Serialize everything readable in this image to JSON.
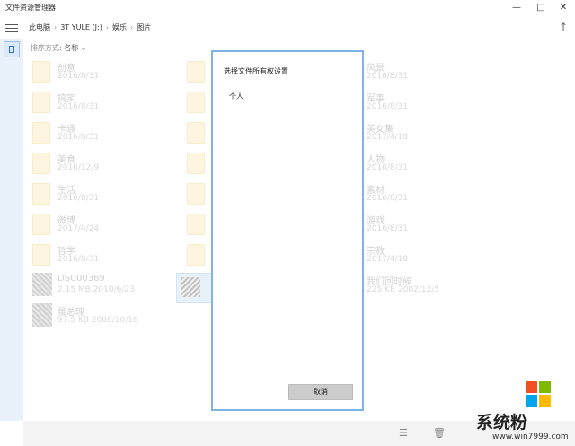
{
  "window": {
    "title": "文件资源管理器"
  },
  "nav": {
    "crumbs": [
      "此电脑",
      "3T YULE (J:)",
      "娱乐",
      "图片"
    ]
  },
  "sort": {
    "label": "排序方式:",
    "value": "名称"
  },
  "files": [
    {
      "name": "创意",
      "date": "2016/8/31",
      "kind": "folder"
    },
    {
      "name": "搞笑",
      "date": "2016/8/31",
      "kind": "folder"
    },
    {
      "name": "卡通",
      "date": "2016/8/31",
      "kind": "folder"
    },
    {
      "name": "美食",
      "date": "2016/12/9",
      "kind": "folder"
    },
    {
      "name": "生活",
      "date": "2016/8/31",
      "kind": "folder"
    },
    {
      "name": "微博",
      "date": "2017/4/24",
      "kind": "folder"
    },
    {
      "name": "哲学",
      "date": "2016/8/31",
      "kind": "folder"
    },
    {
      "name": "DSC00369",
      "date": "2.15 MB 2010/6/23",
      "kind": "image"
    },
    {
      "name": "虽总理",
      "date": "97.5 KB 2006/10/16",
      "kind": "image"
    },
    {
      "name": "风景",
      "date": "2016/8/31",
      "kind": "folder"
    },
    {
      "name": "军事",
      "date": "2016/8/31",
      "kind": "folder"
    },
    {
      "name": "美女集",
      "date": "2017/4/18",
      "kind": "folder"
    },
    {
      "name": "人物",
      "date": "2016/8/31",
      "kind": "folder"
    },
    {
      "name": "素材",
      "date": "2016/8/31",
      "kind": "folder"
    },
    {
      "name": "游戏",
      "date": "2016/8/31",
      "kind": "folder"
    },
    {
      "name": "宗教",
      "date": "2017/4/18",
      "kind": "folder"
    },
    {
      "name": "我们回时候",
      "date": "225 KB 2002/12/5",
      "kind": "image"
    }
  ],
  "dialog": {
    "title": "选择文件所有权设置",
    "option": "个人",
    "cancel_label": "取消"
  },
  "watermark": {
    "brand": "系统粉",
    "url": "www.win7999.com"
  },
  "icons": {
    "hamburger": "hamburger-icon",
    "up": "up-arrow-icon",
    "view": "list-view-icon",
    "delete": "trash-icon"
  },
  "colors": {
    "dialog_border": "#7fb2e5",
    "folder": "#fbe9b8",
    "accent": "#0078d7"
  }
}
